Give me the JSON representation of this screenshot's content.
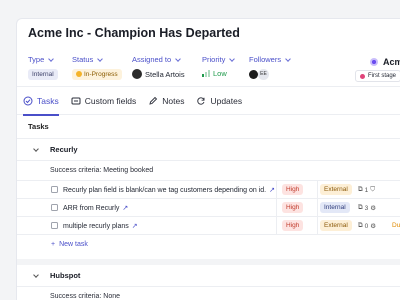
{
  "header": {
    "title": "Acme Inc - Champion Has Departed",
    "fields": {
      "type": {
        "label": "Type",
        "value": "Internal"
      },
      "status": {
        "label": "Status",
        "value": "In-Progress"
      },
      "assigned": {
        "label": "Assigned to",
        "value": "Stella Artois"
      },
      "priority": {
        "label": "Priority",
        "value": "Low"
      },
      "followers": {
        "label": "Followers",
        "value": "EE"
      }
    },
    "company": "Acme",
    "stage": "First stage"
  },
  "tabs": [
    {
      "label": "Tasks",
      "icon": "checklist-icon"
    },
    {
      "label": "Custom fields",
      "icon": "custom-fields-icon"
    },
    {
      "label": "Notes",
      "icon": "pencil-icon"
    },
    {
      "label": "Updates",
      "icon": "refresh-icon"
    }
  ],
  "tasks_title": "Tasks",
  "groups": [
    {
      "name": "Recurly",
      "criteria": "Success criteria: Meeting booked",
      "tasks": [
        {
          "name": "Recurly plan field is blank/can we tag customers depending on id.",
          "priority": "High",
          "type": "External",
          "count": "1",
          "due": ""
        },
        {
          "name": "ARR from Recurly",
          "priority": "High",
          "type": "Internal",
          "count": "3",
          "due": ""
        },
        {
          "name": "multiple recurly plans",
          "priority": "High",
          "type": "External",
          "count": "0",
          "due": "Du"
        }
      ],
      "new_task_label": "New task"
    },
    {
      "name": "Hubspot",
      "criteria": "Success criteria: None"
    }
  ]
}
